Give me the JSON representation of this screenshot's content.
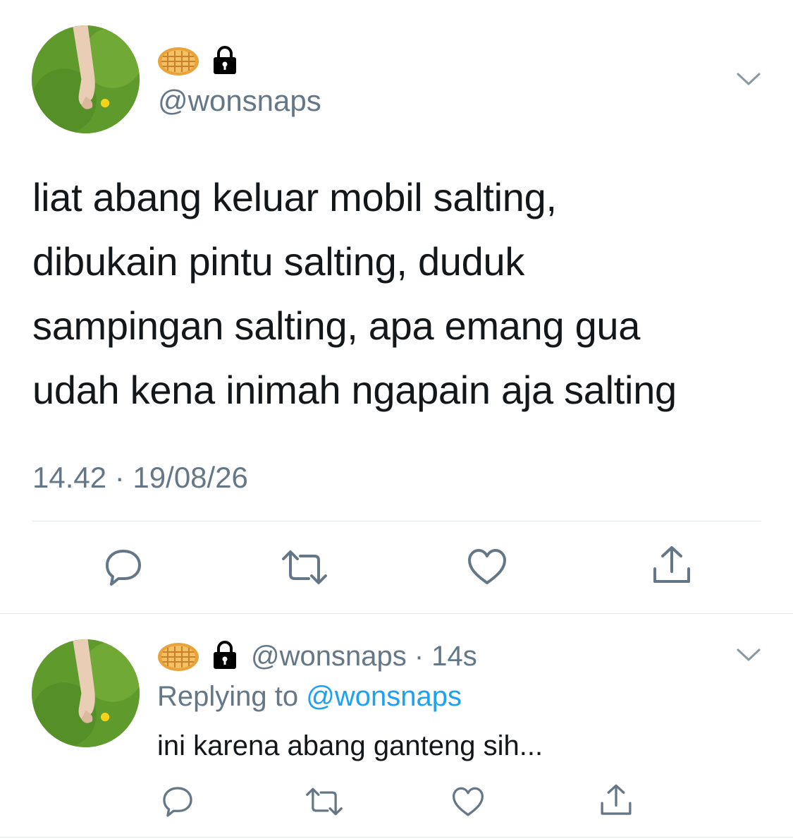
{
  "main_tweet": {
    "display_name_emojis": [
      "waffle-emoji",
      "lock-icon"
    ],
    "handle": "@wonsnaps",
    "text_lines": [
      "liat abang keluar mobil salting,",
      "dibukain pintu salting, duduk",
      "sampingan salting, apa emang gua",
      "udah kena inimah ngapain aja salting"
    ],
    "timestamp": "14.42 · 19/08/26",
    "actions": [
      "reply-icon",
      "retweet-icon",
      "like-icon",
      "share-icon"
    ]
  },
  "reply_tweet": {
    "display_name_emojis": [
      "waffle-emoji",
      "lock-icon"
    ],
    "handle": "@wonsnaps",
    "time": "· 14s",
    "replying_label": "Replying to",
    "replying_handle": "@wonsnaps",
    "text": "ini karena abang ganteng sih...",
    "actions": [
      "reply-icon",
      "retweet-icon",
      "like-icon",
      "share-icon"
    ]
  },
  "colors": {
    "text": "#14171a",
    "secondary": "#657786",
    "link": "#1da1f2",
    "divider": "#e1e8ed"
  }
}
